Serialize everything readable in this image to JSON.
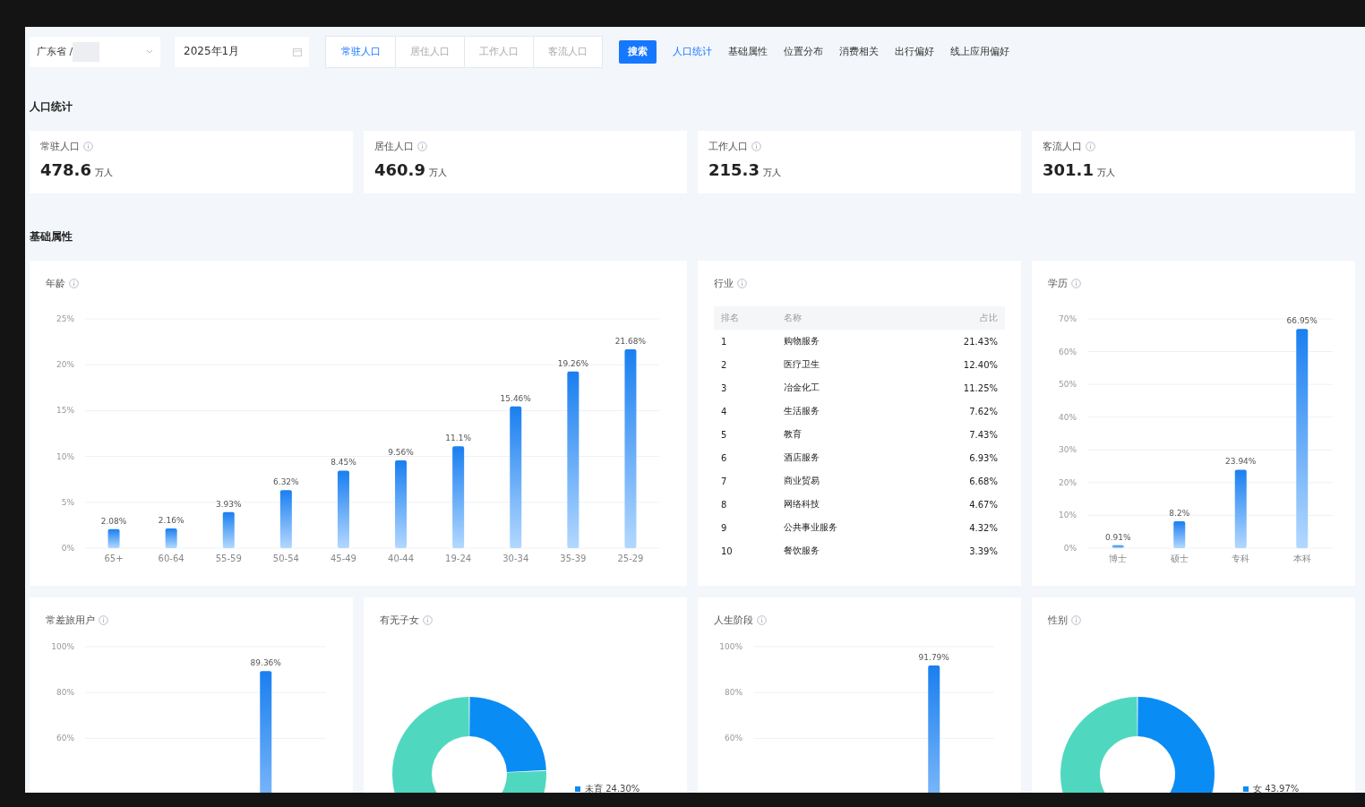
{
  "filters": {
    "region": {
      "value": "广东省 / "
    },
    "month": {
      "value": "2025年1月"
    },
    "population_tabs": [
      {
        "label": "常驻人口",
        "selected": true
      },
      {
        "label": "居住人口",
        "selected": false
      },
      {
        "label": "工作人口",
        "selected": false
      },
      {
        "label": "客流人口",
        "selected": false
      }
    ],
    "search_button": "搜索"
  },
  "anchor_nav": [
    {
      "label": "人口统计",
      "selected": true
    },
    {
      "label": "基础属性",
      "selected": false
    },
    {
      "label": "位置分布",
      "selected": false
    },
    {
      "label": "消费相关",
      "selected": false
    },
    {
      "label": "出行偏好",
      "selected": false
    },
    {
      "label": "线上应用偏好",
      "selected": false
    }
  ],
  "population_section": {
    "title": "人口统计",
    "cards": [
      {
        "label": "常驻人口",
        "value": "478.6",
        "unit": "万人"
      },
      {
        "label": "居住人口",
        "value": "460.9",
        "unit": "万人"
      },
      {
        "label": "工作人口",
        "value": "215.3",
        "unit": "万人"
      },
      {
        "label": "客流人口",
        "value": "301.1",
        "unit": "万人"
      }
    ]
  },
  "basic_section": {
    "title": "基础属性",
    "age": {
      "title": "年龄",
      "chart_data": {
        "type": "bar",
        "categories": [
          "65+",
          "60-64",
          "55-59",
          "50-54",
          "45-49",
          "40-44",
          "19-24",
          "30-34",
          "35-39",
          "25-29"
        ],
        "values": [
          2.08,
          2.16,
          3.93,
          6.32,
          8.45,
          9.56,
          11.1,
          15.46,
          19.26,
          21.68
        ],
        "grid": true,
        "value_labels": [
          "2.08%",
          "2.16%",
          "3.93%",
          "6.32%",
          "8.45%",
          "9.56%",
          "11.1%",
          "15.46%",
          "19.26%",
          "21.68%"
        ],
        "ylim": [
          0,
          25
        ],
        "yticks": [
          {
            "value": 0,
            "label": "0%"
          },
          {
            "value": 5,
            "label": "5%"
          },
          {
            "value": 10,
            "label": "10%"
          },
          {
            "value": 15,
            "label": "15%"
          },
          {
            "value": 20,
            "label": "20%"
          },
          {
            "value": 25,
            "label": "25%"
          }
        ]
      }
    },
    "industry": {
      "title": "行业",
      "columns": [
        "排名",
        "名称",
        "占比"
      ],
      "rows": [
        [
          "1",
          "购物服务",
          "21.43%"
        ],
        [
          "2",
          "医疗卫生",
          "12.40%"
        ],
        [
          "3",
          "冶金化工",
          "11.25%"
        ],
        [
          "4",
          "生活服务",
          "7.62%"
        ],
        [
          "5",
          "教育",
          "7.43%"
        ],
        [
          "6",
          "酒店服务",
          "6.93%"
        ],
        [
          "7",
          "商业贸易",
          "6.68%"
        ],
        [
          "8",
          "网络科技",
          "4.67%"
        ],
        [
          "9",
          "公共事业服务",
          "4.32%"
        ],
        [
          "10",
          "餐饮服务",
          "3.39%"
        ]
      ]
    },
    "education": {
      "title": "学历",
      "chart_data": {
        "type": "bar",
        "categories": [
          "博士",
          "硕士",
          "专科",
          "本科"
        ],
        "values": [
          0.91,
          8.2,
          23.94,
          66.95
        ],
        "grid": true,
        "value_labels": [
          "0.91%",
          "8.2%",
          "23.94%",
          "66.95%"
        ],
        "ylim": [
          0,
          70
        ],
        "yticks": [
          {
            "value": 0,
            "label": "0%"
          },
          {
            "value": 10,
            "label": "10%"
          },
          {
            "value": 20,
            "label": "20%"
          },
          {
            "value": 30,
            "label": "30%"
          },
          {
            "value": 40,
            "label": "40%"
          },
          {
            "value": 50,
            "label": "50%"
          },
          {
            "value": 60,
            "label": "60%"
          },
          {
            "value": 70,
            "label": "70%"
          }
        ]
      }
    }
  },
  "bottom_cards": [
    {
      "title": "常差旅用户",
      "chart_data": {
        "type": "bar",
        "grid": true,
        "values": [
          null,
          89.36
        ],
        "value_labels": [
          null,
          "89.36%"
        ],
        "ylim": [
          0,
          100
        ],
        "yticks": [
          {
            "value": 60,
            "label": "60%"
          },
          {
            "value": 80,
            "label": "80%"
          },
          {
            "value": 100,
            "label": "100%"
          }
        ]
      }
    },
    {
      "title": "有无子女",
      "chart_data": {
        "type": "donut",
        "categories": [
          "未育",
          null
        ],
        "values": [
          24.3,
          75.7
        ],
        "value_labels": [
          "24.30%",
          null
        ],
        "colors": [
          "#0a8cf5",
          "#4fd8bf"
        ]
      }
    },
    {
      "title": "人生阶段",
      "chart_data": {
        "type": "bar",
        "grid": true,
        "values": [
          null,
          91.79
        ],
        "value_labels": [
          null,
          "91.79%"
        ],
        "ylim": [
          0,
          100
        ],
        "yticks": [
          {
            "value": 60,
            "label": "60%"
          },
          {
            "value": 80,
            "label": "80%"
          },
          {
            "value": 100,
            "label": "100%"
          }
        ]
      }
    },
    {
      "title": "性别",
      "chart_data": {
        "type": "donut",
        "categories": [
          "女",
          null
        ],
        "values": [
          43.97,
          56.03
        ],
        "value_labels": [
          "43.97%",
          null
        ],
        "colors": [
          "#0a8cf5",
          "#4fd8bf"
        ]
      }
    }
  ]
}
